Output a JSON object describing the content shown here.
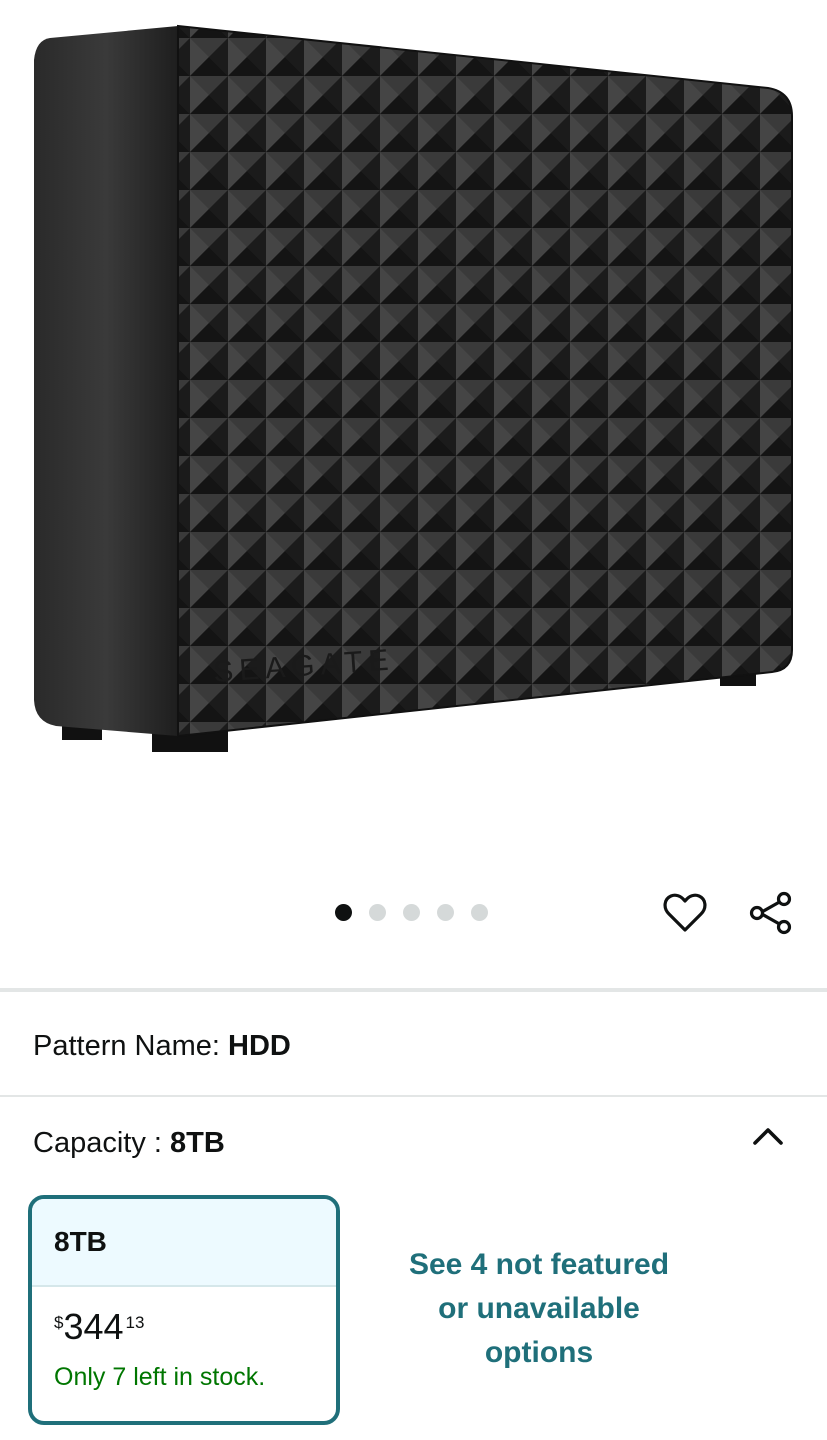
{
  "product_image": {
    "alt": "Seagate external hard drive",
    "brand_mark": "SEAGATE"
  },
  "carousel": {
    "count": 5,
    "active_index": 0
  },
  "icons": {
    "wishlist": "heart-icon",
    "share": "share-icon",
    "collapse": "chevron-up-icon"
  },
  "pattern": {
    "label": "Pattern Name:",
    "value": "HDD"
  },
  "capacity": {
    "label": "Capacity :",
    "value": "8TB"
  },
  "selected_option": {
    "name": "8TB",
    "price_symbol": "$",
    "price_whole": "344",
    "price_fraction": "13",
    "stock": "Only 7 left in stock."
  },
  "more_options": {
    "line1": "See 4 not featured",
    "line2": "or unavailable",
    "line3": "options"
  },
  "colors": {
    "accent": "#1f6f7a",
    "stock_green": "#007600",
    "card_header": "#edfaff"
  }
}
